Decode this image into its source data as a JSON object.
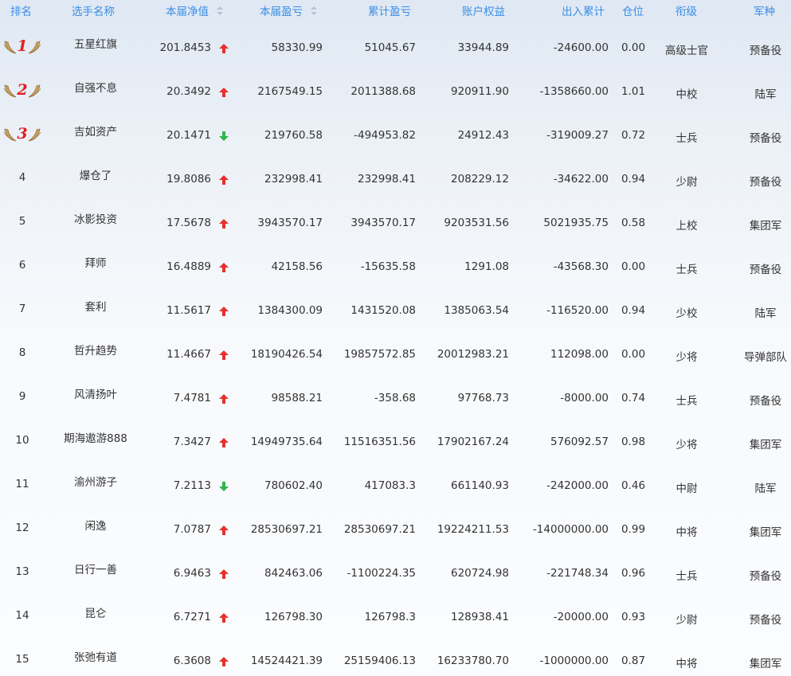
{
  "colors": {
    "header_text": "#3a8ee6",
    "up_arrow": "#e8302c",
    "down_arrow": "#2db54a",
    "medal_digit": "#e02020",
    "wing": "#c8a060"
  },
  "headers": {
    "rank": "排名",
    "name": "选手名称",
    "nav": "本届净值",
    "pl": "本届盈亏",
    "cum": "累计盈亏",
    "equity": "账户权益",
    "flow": "出入累计",
    "position": "仓位",
    "title": "衔级",
    "arm": "军种"
  },
  "rows": [
    {
      "rank": "1",
      "medal": "1",
      "name": "五星红旗",
      "nav": "201.8453",
      "trend": "up",
      "pl": "58330.99",
      "cum": "51045.67",
      "equity": "33944.89",
      "flow": "-24600.00",
      "position": "0.00",
      "title": "高级士官",
      "arm": "预备役"
    },
    {
      "rank": "2",
      "medal": "2",
      "name": "自强不息",
      "nav": "20.3492",
      "trend": "up",
      "pl": "2167549.15",
      "cum": "2011388.68",
      "equity": "920911.90",
      "flow": "-1358660.00",
      "position": "1.01",
      "title": "中校",
      "arm": "陆军"
    },
    {
      "rank": "3",
      "medal": "3",
      "name": "吉如资产",
      "nav": "20.1471",
      "trend": "down",
      "pl": "219760.58",
      "cum": "-494953.82",
      "equity": "24912.43",
      "flow": "-319009.27",
      "position": "0.72",
      "title": "士兵",
      "arm": "预备役"
    },
    {
      "rank": "4",
      "medal": "",
      "name": "爆仓了",
      "nav": "19.8086",
      "trend": "up",
      "pl": "232998.41",
      "cum": "232998.41",
      "equity": "208229.12",
      "flow": "-34622.00",
      "position": "0.94",
      "title": "少尉",
      "arm": "预备役"
    },
    {
      "rank": "5",
      "medal": "",
      "name": "冰影投资",
      "nav": "17.5678",
      "trend": "up",
      "pl": "3943570.17",
      "cum": "3943570.17",
      "equity": "9203531.56",
      "flow": "5021935.75",
      "position": "0.58",
      "title": "上校",
      "arm": "集团军"
    },
    {
      "rank": "6",
      "medal": "",
      "name": "拜师",
      "nav": "16.4889",
      "trend": "up",
      "pl": "42158.56",
      "cum": "-15635.58",
      "equity": "1291.08",
      "flow": "-43568.30",
      "position": "0.00",
      "title": "士兵",
      "arm": "预备役"
    },
    {
      "rank": "7",
      "medal": "",
      "name": "套利",
      "nav": "11.5617",
      "trend": "up",
      "pl": "1384300.09",
      "cum": "1431520.08",
      "equity": "1385063.54",
      "flow": "-116520.00",
      "position": "0.94",
      "title": "少校",
      "arm": "陆军"
    },
    {
      "rank": "8",
      "medal": "",
      "name": "哲升趋势",
      "nav": "11.4667",
      "trend": "up",
      "pl": "18190426.54",
      "cum": "19857572.85",
      "equity": "20012983.21",
      "flow": "112098.00",
      "position": "0.00",
      "title": "少将",
      "arm": "导弹部队"
    },
    {
      "rank": "9",
      "medal": "",
      "name": "风清扬叶",
      "nav": "7.4781",
      "trend": "up",
      "pl": "98588.21",
      "cum": "-358.68",
      "equity": "97768.73",
      "flow": "-8000.00",
      "position": "0.74",
      "title": "士兵",
      "arm": "预备役"
    },
    {
      "rank": "10",
      "medal": "",
      "name": "期海遨游888",
      "nav": "7.3427",
      "trend": "up",
      "pl": "14949735.64",
      "cum": "11516351.56",
      "equity": "17902167.24",
      "flow": "576092.57",
      "position": "0.98",
      "title": "少将",
      "arm": "集团军"
    },
    {
      "rank": "11",
      "medal": "",
      "name": "渝州游子",
      "nav": "7.2113",
      "trend": "down",
      "pl": "780602.40",
      "cum": "417083.3",
      "equity": "661140.93",
      "flow": "-242000.00",
      "position": "0.46",
      "title": "中尉",
      "arm": "陆军"
    },
    {
      "rank": "12",
      "medal": "",
      "name": "闲逸",
      "nav": "7.0787",
      "trend": "up",
      "pl": "28530697.21",
      "cum": "28530697.21",
      "equity": "19224211.53",
      "flow": "-14000000.00",
      "position": "0.99",
      "title": "中将",
      "arm": "集团军"
    },
    {
      "rank": "13",
      "medal": "",
      "name": "日行一善",
      "nav": "6.9463",
      "trend": "up",
      "pl": "842463.06",
      "cum": "-1100224.35",
      "equity": "620724.98",
      "flow": "-221748.34",
      "position": "0.96",
      "title": "士兵",
      "arm": "预备役"
    },
    {
      "rank": "14",
      "medal": "",
      "name": "昆仑",
      "nav": "6.7271",
      "trend": "up",
      "pl": "126798.30",
      "cum": "126798.3",
      "equity": "128938.41",
      "flow": "-20000.00",
      "position": "0.93",
      "title": "少尉",
      "arm": "预备役"
    },
    {
      "rank": "15",
      "medal": "",
      "name": "张弛有道",
      "nav": "6.3608",
      "trend": "up",
      "pl": "14524421.39",
      "cum": "25159406.13",
      "equity": "16233780.70",
      "flow": "-1000000.00",
      "position": "0.87",
      "title": "中将",
      "arm": "集团军"
    }
  ]
}
